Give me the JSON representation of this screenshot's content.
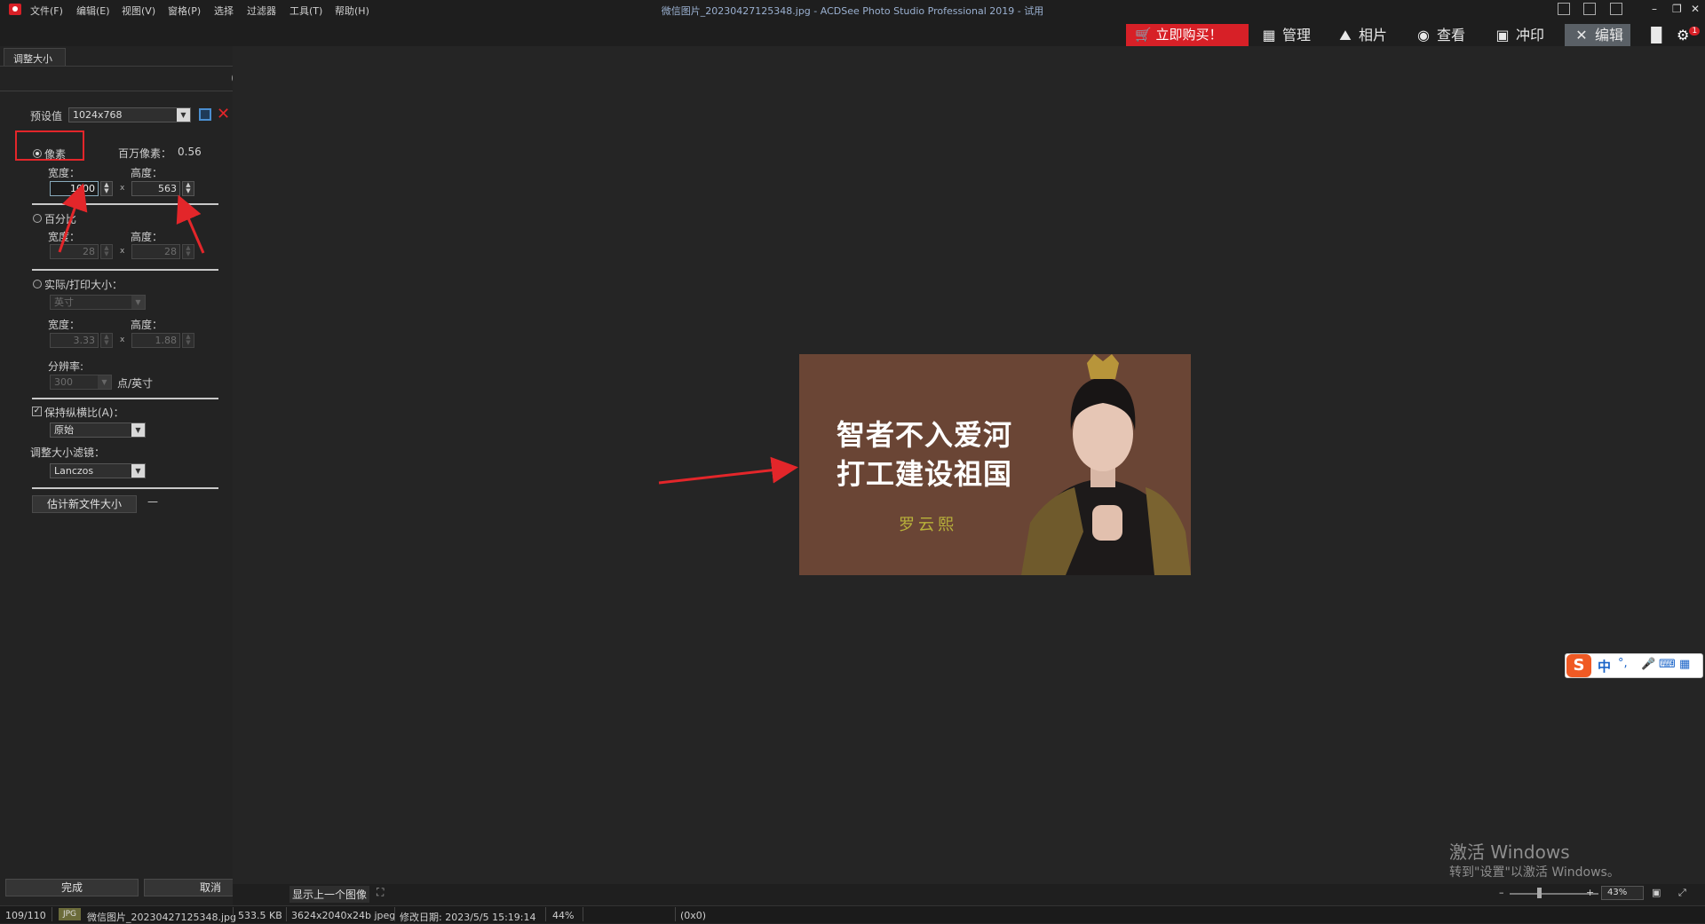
{
  "menu": {
    "items": [
      "文件(F)",
      "编辑(E)",
      "视图(V)",
      "窗格(P)",
      "选择",
      "过滤器",
      "工具(T)",
      "帮助(H)"
    ]
  },
  "window": {
    "title": "微信图片_20230427125348.jpg - ACDSee Photo Studio Professional 2019 - 试用"
  },
  "modes": {
    "buy": "立即购买！",
    "manage": "管理",
    "photos": "相片",
    "view": "查看",
    "develop": "冲印",
    "edit": "编辑"
  },
  "panel": {
    "tab": "调整大小",
    "preset_label": "预设值",
    "preset_value": "1024x768",
    "pixels_label": "像素",
    "megapixels_label": "百万像素：",
    "megapixels_value": "0.56",
    "width_label": "宽度：",
    "height_label": "高度：",
    "pixel_width": "1000",
    "pixel_height": "563",
    "percent_label": "百分比",
    "percent_width": "28",
    "percent_height": "28",
    "actual_label": "实际/打印大小：",
    "unit_value": "英寸",
    "print_width": "3.33",
    "print_height": "1.88",
    "resolution_label": "分辨率:",
    "resolution_value": "300",
    "resolution_unit": "点/英寸",
    "keep_ratio_label": "保持纵横比(A)：",
    "ratio_value": "原始",
    "filter_label": "调整大小滤镜：",
    "filter_value": "Lanczos",
    "estimate_button": "估计新文件大小",
    "estimate_result": "—",
    "done_button": "完成",
    "cancel_button": "取消",
    "x_sign": "x"
  },
  "image": {
    "line1": "智者不入爱河",
    "line2": "打工建设祖国",
    "signature": "罗云熙"
  },
  "bottom": {
    "show_prev": "显示上一个图像"
  },
  "status": {
    "index": "109/110",
    "format": "JPG",
    "filename": "微信图片_20230427125348.jpg",
    "filesize": "533.5 KB",
    "dimensions": "3624x2040x24b jpeg",
    "modified": "修改日期: 2023/5/5 15:19:14",
    "zoom": "44%",
    "coords": "(0x0)",
    "zoom_box": "43%"
  },
  "watermark": {
    "title": "激活 Windows",
    "subtitle": "转到\"设置\"以激活 Windows。"
  },
  "ime": {
    "logo": "S",
    "lang": "中",
    "punct": "°,",
    "mic": "🎤",
    "kbd": "⌨",
    "grid": "▦"
  },
  "colors": {
    "accent_red": "#d72027",
    "annotation_red": "#e3262a",
    "panel_bg": "#232323",
    "canvas_bg": "#252525"
  },
  "icons": [
    "app-camera-icon",
    "save-icon",
    "delete-icon",
    "help-icon",
    "pin-icon",
    "close-icon",
    "cart-icon",
    "grid-icon",
    "photos-icon",
    "eye-icon",
    "develop-icon",
    "edit-tools-icon",
    "histogram-icon",
    "notification-icon",
    "fullscreen-icon"
  ]
}
